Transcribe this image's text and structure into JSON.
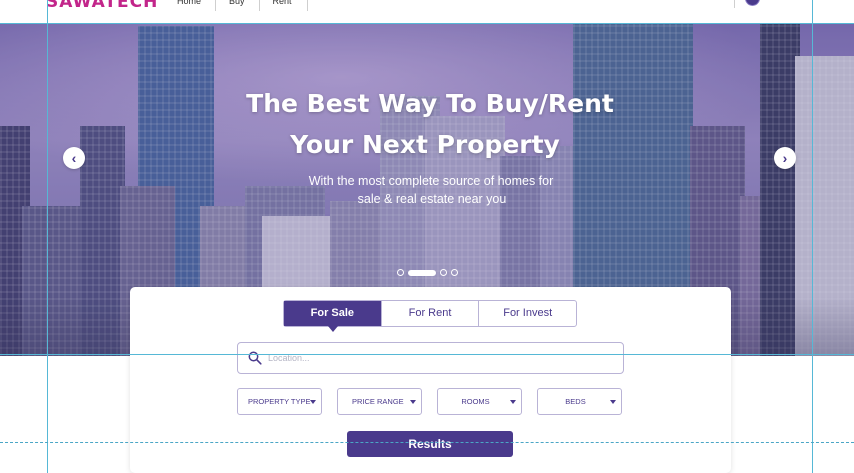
{
  "header": {
    "logo_text": "SAWATECH",
    "nav_items": [
      "Home",
      "Buy",
      "Rent"
    ]
  },
  "hero": {
    "title_line1": "The Best Way To Buy/Rent",
    "title_line2": "Your Next Property",
    "subtitle_line1": "With the most complete source of homes for",
    "subtitle_line2": "sale & real estate near you",
    "slide_count": 4,
    "active_slide": 1
  },
  "search": {
    "tabs": [
      {
        "label": "For Sale",
        "active": true
      },
      {
        "label": "For Rent",
        "active": false
      },
      {
        "label": "For Invest",
        "active": false
      }
    ],
    "location_placeholder": "Location...",
    "filters": [
      "PROPERTY TYPE",
      "PRICE RANGE",
      "ROOMS",
      "BEDS"
    ],
    "results_label": "Results"
  },
  "colors": {
    "brand": "#c2258a",
    "accent": "#4a3a8c",
    "guide": "#56b8d6"
  },
  "icons": [
    "chevron-left-icon",
    "chevron-right-icon",
    "search-icon",
    "caret-down-icon"
  ]
}
